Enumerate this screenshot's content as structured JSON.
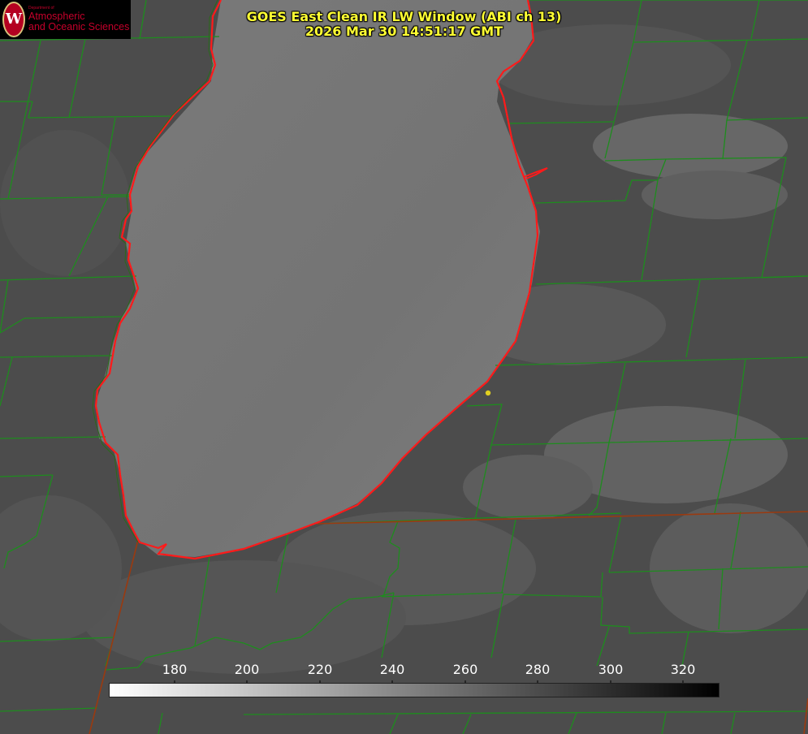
{
  "title": {
    "line1": "GOES East Clean IR LW Window (ABI ch 13)",
    "line2": "2026 Mar 30 14:51:17 GMT"
  },
  "logo": {
    "dept": "Department of",
    "line1": "Atmospheric",
    "line2": "and Oceanic Sciences",
    "seal_letter": "W"
  },
  "colorbar": {
    "ticks": [
      "180",
      "200",
      "220",
      "240",
      "260",
      "280",
      "300",
      "320"
    ],
    "range": [
      162,
      330
    ],
    "gradient": "white-to-black"
  },
  "colors": {
    "background_gray": "#4a4a4a",
    "lake_gray": "#777777",
    "county_lines": "#1e8c1e",
    "coastline": "#ff2020",
    "title": "#ffff33",
    "marker": "#e0d020"
  }
}
